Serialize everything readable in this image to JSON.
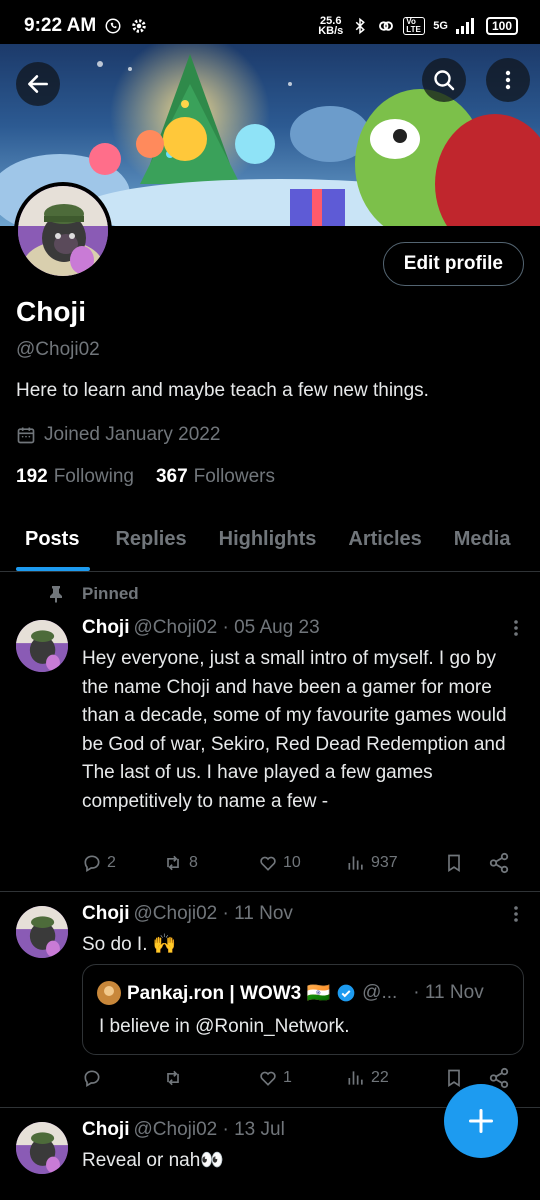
{
  "status_bar": {
    "time": "9:22 AM",
    "net_speed": "25.6",
    "net_unit": "KB/s",
    "volte": "Vo LTE",
    "network": "5G",
    "battery": "100"
  },
  "header": {
    "back_icon": "arrow-left-icon",
    "search_icon": "search-icon",
    "more_icon": "more-vertical-icon"
  },
  "profile": {
    "edit_label": "Edit profile",
    "name": "Choji",
    "handle": "@Choji02",
    "bio": "Here to learn and maybe teach a few new things.",
    "joined": "Joined January 2022",
    "following_count": "192",
    "following_label": "Following",
    "followers_count": "367",
    "followers_label": "Followers"
  },
  "tabs": [
    "Posts",
    "Replies",
    "Highlights",
    "Articles",
    "Media"
  ],
  "pinned_label": "Pinned",
  "tweets": [
    {
      "name": "Choji",
      "handle_date": "@Choji02 · 05 Aug 23",
      "text": "Hey everyone, just a small intro of myself. I go by the name Choji and have been a gamer for more than a decade, some of my favourite games would be God of war, Sekiro, Red Dead Redemption and  The last of us. I have played a few games competitively to name a few -",
      "replies": "2",
      "retweets": "8",
      "likes": "10",
      "views": "937"
    },
    {
      "name": "Choji",
      "handle_date": "@Choji02 · 11 Nov",
      "text": "So do I. 🙌",
      "quote": {
        "name": "Pankaj.ron | WOW3 🇮🇳",
        "handle": "@...",
        "date": "· 11 Nov",
        "text": "I believe in @Ronin_Network."
      },
      "replies": "",
      "retweets": "",
      "likes": "1",
      "views": "22"
    },
    {
      "name": "Choji",
      "handle_date": "@Choji02 · 13 Jul",
      "text": "Reveal or nah👀"
    }
  ],
  "colors": {
    "accent": "#1d9bf0",
    "background": "#000000",
    "muted": "#71767b",
    "border": "#2f3336"
  },
  "fab_icon": "plus-icon"
}
